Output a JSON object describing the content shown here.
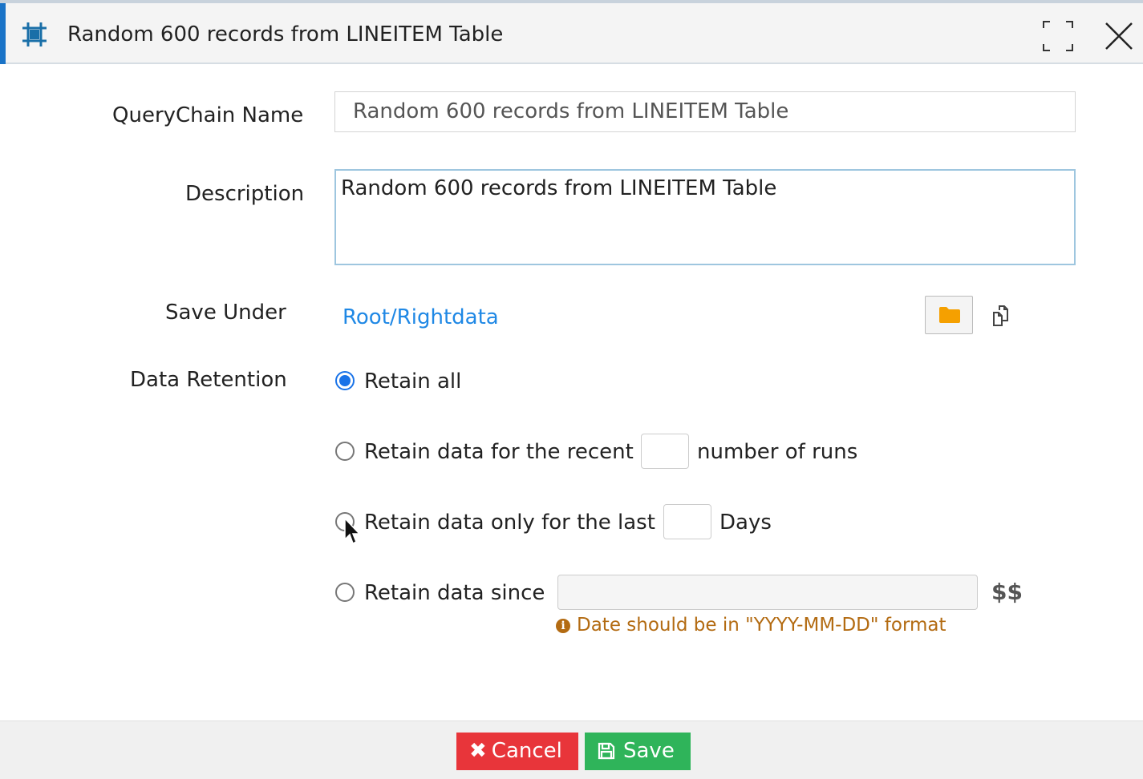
{
  "header": {
    "title": "Random 600 records from LINEITEM Table",
    "icon": "crop-frame-icon",
    "maximize_icon": "maximize-icon",
    "close_icon": "close-icon"
  },
  "form": {
    "querychain_name_label": "QueryChain Name",
    "querychain_name_value": "Random 600 records from LINEITEM Table",
    "description_label": "Description",
    "description_value": "Random 600 records from LINEITEM Table",
    "save_under_label": "Save Under",
    "save_under_value": "Root/Rightdata",
    "folder_icon": "folder-icon",
    "copy_icon": "copy-icon",
    "data_retention_label": "Data Retention",
    "retention_options": [
      {
        "label": "Retain all",
        "selected": true
      },
      {
        "label": "Retain data for the recent",
        "suffix": "number of runs",
        "value": "",
        "selected": false
      },
      {
        "label": "Retain data only for the last",
        "suffix": "Days",
        "value": "",
        "selected": false
      },
      {
        "label": "Retain data since",
        "value": "",
        "selected": false
      }
    ],
    "parameter_symbol": "$$",
    "date_hint": "Date should be in \"YYYY-MM-DD\" format"
  },
  "footer": {
    "cancel_label": "Cancel",
    "save_label": "Save"
  },
  "colors": {
    "accent": "#1a73c7",
    "link": "#1f88e5",
    "cancel": "#e8353a",
    "save": "#2fb45a",
    "folder": "#f5a000",
    "hint": "#b36b12"
  }
}
